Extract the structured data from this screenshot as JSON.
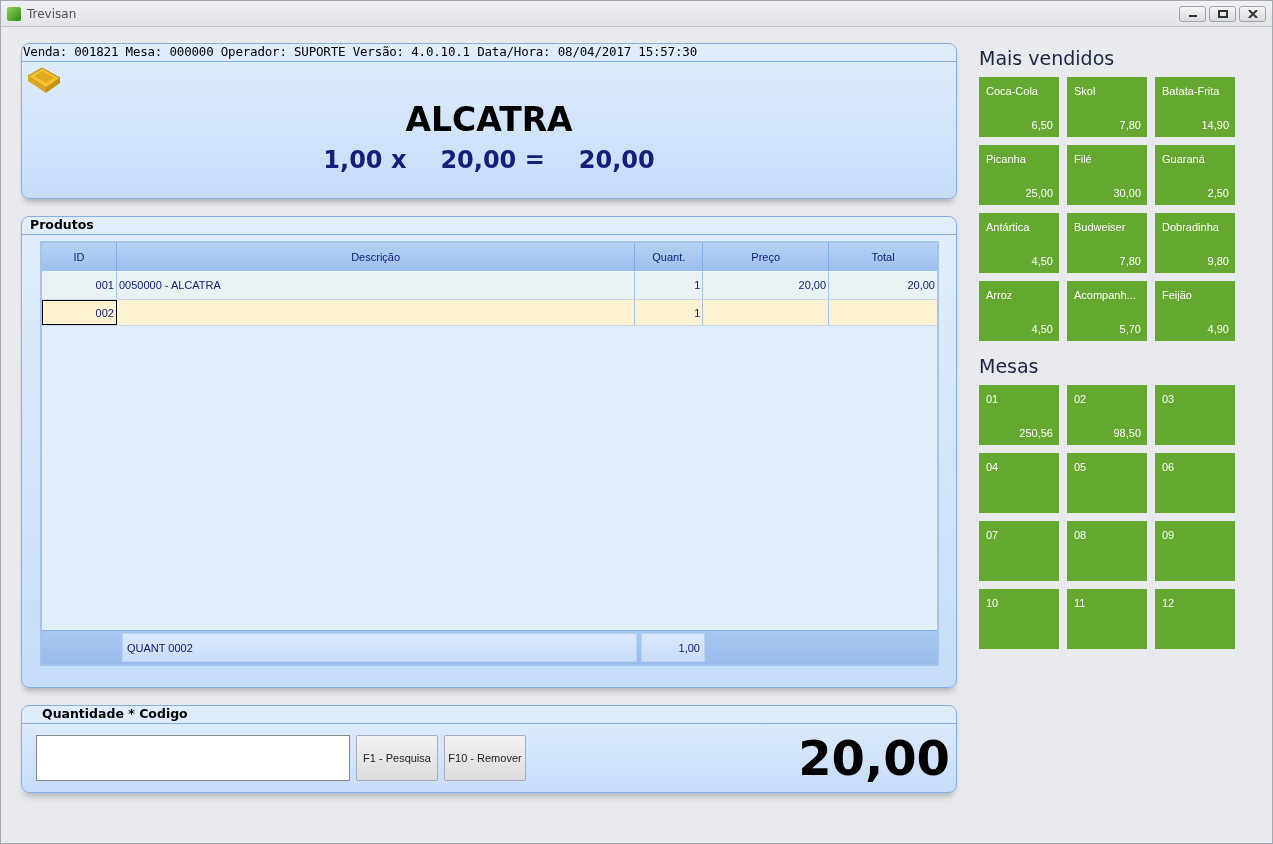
{
  "window": {
    "title": "Trevisan"
  },
  "sale_panel": {
    "info": "Venda: 001821 Mesa: 000000 Operador: SUPORTE Versão: 4.0.10.1 Data/Hora: 08/04/2017 15:57:30",
    "product": "ALCATRA",
    "quantity": "1,00 x",
    "price": "20,00 =",
    "subtotal": "20,00"
  },
  "products": {
    "title": "Produtos",
    "columns": [
      "ID",
      "Descrição",
      "Quant.",
      "Preço",
      "Total"
    ],
    "rows": [
      {
        "selected": false,
        "cells": [
          "001",
          "0050000 - ALCATRA",
          "1",
          "20,00",
          "20,00"
        ]
      },
      {
        "selected": true,
        "cells": [
          "002",
          "",
          "1",
          "",
          ""
        ]
      }
    ],
    "footer": {
      "count": "QUANT 0002",
      "quantity": "1,00"
    }
  },
  "entry": {
    "title": "Quantidade * Codigo",
    "buttons": [
      "F1 - Pesquisa",
      "F10 - Remover"
    ],
    "total": "20,00"
  },
  "best_sellers": {
    "title": "Mais vendidos",
    "items": [
      {
        "name": "Coca-Cola",
        "price": "6,50"
      },
      {
        "name": "Skol",
        "price": "7,80"
      },
      {
        "name": "Batata-Frita",
        "price": "14,90"
      },
      {
        "name": "Picanha",
        "price": "25,00"
      },
      {
        "name": "Filé",
        "price": "30,00"
      },
      {
        "name": "Guaraná",
        "price": "2,50"
      },
      {
        "name": "Antártica",
        "price": "4,50"
      },
      {
        "name": "Budweiser",
        "price": "7,80"
      },
      {
        "name": "Dobradinha",
        "price": "9,80"
      },
      {
        "name": "Arroz",
        "price": "4,50"
      },
      {
        "name": "Acompanh...",
        "price": "5,70"
      },
      {
        "name": "Feijão",
        "price": "4,90"
      }
    ]
  },
  "tables": {
    "title": "Mesas",
    "items": [
      {
        "name": "01",
        "price": "250,56"
      },
      {
        "name": "02",
        "price": "98,50"
      },
      {
        "name": "03"
      },
      {
        "name": "04"
      },
      {
        "name": "05"
      },
      {
        "name": "06"
      },
      {
        "name": "07"
      },
      {
        "name": "08"
      },
      {
        "name": "09"
      },
      {
        "name": "10"
      },
      {
        "name": "11"
      },
      {
        "name": "12"
      }
    ]
  }
}
